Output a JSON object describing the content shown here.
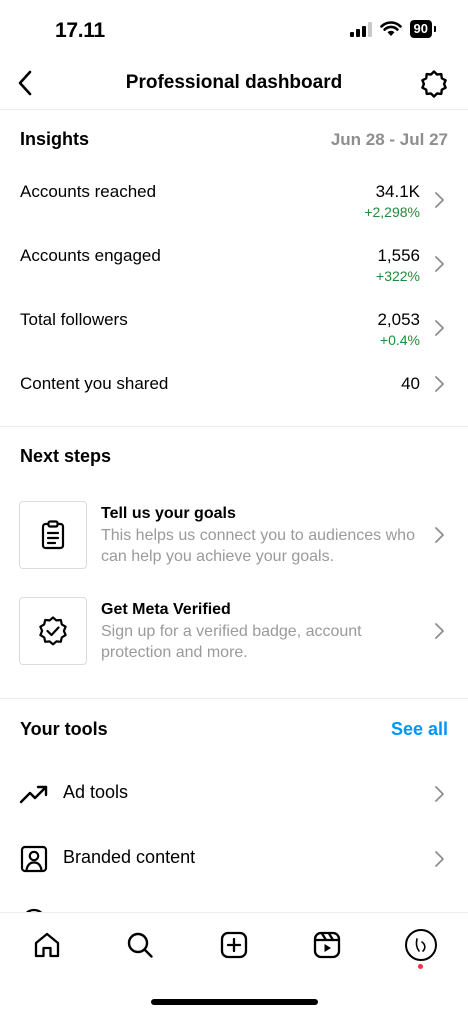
{
  "status_bar": {
    "time": "17.11",
    "battery": "90"
  },
  "header": {
    "title": "Professional dashboard"
  },
  "insights": {
    "title": "Insights",
    "date_range": "Jun 28 - Jul 27",
    "metrics": [
      {
        "label": "Accounts reached",
        "value": "34.1K",
        "change": "+2,298%"
      },
      {
        "label": "Accounts engaged",
        "value": "1,556",
        "change": "+322%"
      },
      {
        "label": "Total followers",
        "value": "2,053",
        "change": "+0.4%"
      },
      {
        "label": "Content you shared",
        "value": "40",
        "change": ""
      }
    ]
  },
  "next_steps": {
    "title": "Next steps",
    "items": [
      {
        "title": "Tell us your goals",
        "desc": "This helps us connect you to audiences who can help you achieve your goals.",
        "icon": "clipboard-icon"
      },
      {
        "title": "Get Meta Verified",
        "desc": "Sign up for a verified badge, account protection and more.",
        "icon": "verified-badge-icon"
      }
    ]
  },
  "tools": {
    "title": "Your tools",
    "see_all": "See all",
    "items": [
      {
        "label": "Ad tools",
        "icon": "trending-up-icon"
      },
      {
        "label": "Branded content",
        "icon": "branded-content-icon"
      }
    ]
  },
  "colors": {
    "accent": "#0095f6",
    "positive": "#1f8c3b",
    "muted": "#8e8e8e",
    "notification": "#ff3040"
  }
}
